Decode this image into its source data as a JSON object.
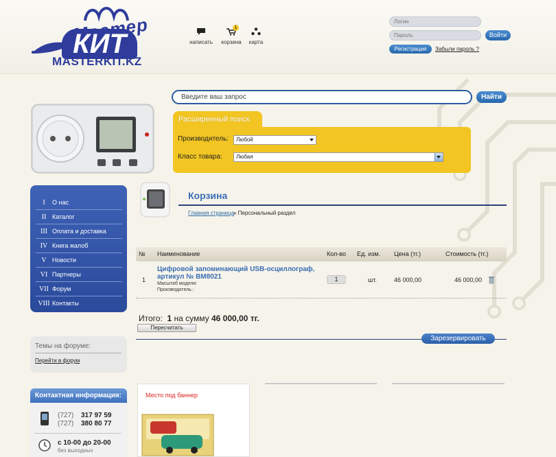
{
  "logo": {
    "top": "Мастер",
    "kit": "КИТ",
    "domain": "MASTERKIT.KZ"
  },
  "top_icons": [
    {
      "label": "написать",
      "icon": "speech-bubble-icon"
    },
    {
      "label": "корзина",
      "icon": "cart-icon",
      "badge": "1"
    },
    {
      "label": "карта",
      "icon": "sitemap-icon"
    }
  ],
  "login": {
    "login_placeholder": "Логин",
    "password_placeholder": "Пароль",
    "submit": "Войти",
    "register": "Регистрация",
    "forgot": "Забыли пароль ?"
  },
  "search": {
    "placeholder": "Введите ваш запрос",
    "button": "Найти"
  },
  "advanced": {
    "tab": "Расширенный поиск",
    "manufacturer_label": "Производитель:",
    "manufacturer_value": "Любой",
    "class_label": "Класс товара:",
    "class_value": "Любая"
  },
  "nav": [
    {
      "num": "I",
      "label": "О нас"
    },
    {
      "num": "II",
      "label": "Каталог"
    },
    {
      "num": "III",
      "label": "Оплата и доставка"
    },
    {
      "num": "IV",
      "label": "Книга жалоб"
    },
    {
      "num": "V",
      "label": "Новости"
    },
    {
      "num": "VI",
      "label": "Партнеры"
    },
    {
      "num": "VII",
      "label": "Форум"
    },
    {
      "num": "VIII",
      "label": "Контакты"
    }
  ],
  "forum": {
    "title": "Темы на форуме:",
    "link": "Перейти в форум"
  },
  "contact": {
    "title": "Контактная информация:",
    "phones": [
      {
        "code": "(727)",
        "number": "317 97 59"
      },
      {
        "code": "(727)",
        "number": "380 80 77"
      }
    ],
    "hours": "с 10-00 до 20-00",
    "hours_sub": "без выходных"
  },
  "cart": {
    "title": "Корзина",
    "breadcrumb_link": "Главная страница",
    "breadcrumb_rest": "» Персональный раздел",
    "headers": {
      "num": "№",
      "name": "Наименование",
      "qty": "Кол-во",
      "unit": "Ед. изм.",
      "price": "Цена (тг.)",
      "cost": "Стоимость (тг.)"
    },
    "row": {
      "num": "1",
      "name": "Цифровой запоминающий USB-осциллограф, артикул № BM8021",
      "scale": "Масштаб модели:",
      "maker": "Производитель.:",
      "qty": "1",
      "unit": "шт.",
      "price": "46 000,00",
      "cost": "46 000,00"
    },
    "total_label": "Итого:",
    "total_count": "1",
    "total_mid": "на сумму",
    "total_sum": "46 000,00 тг.",
    "recalc": "Пересчитать",
    "reserve": "Зарезервировать"
  },
  "banner": {
    "text": "Место под баннер"
  }
}
